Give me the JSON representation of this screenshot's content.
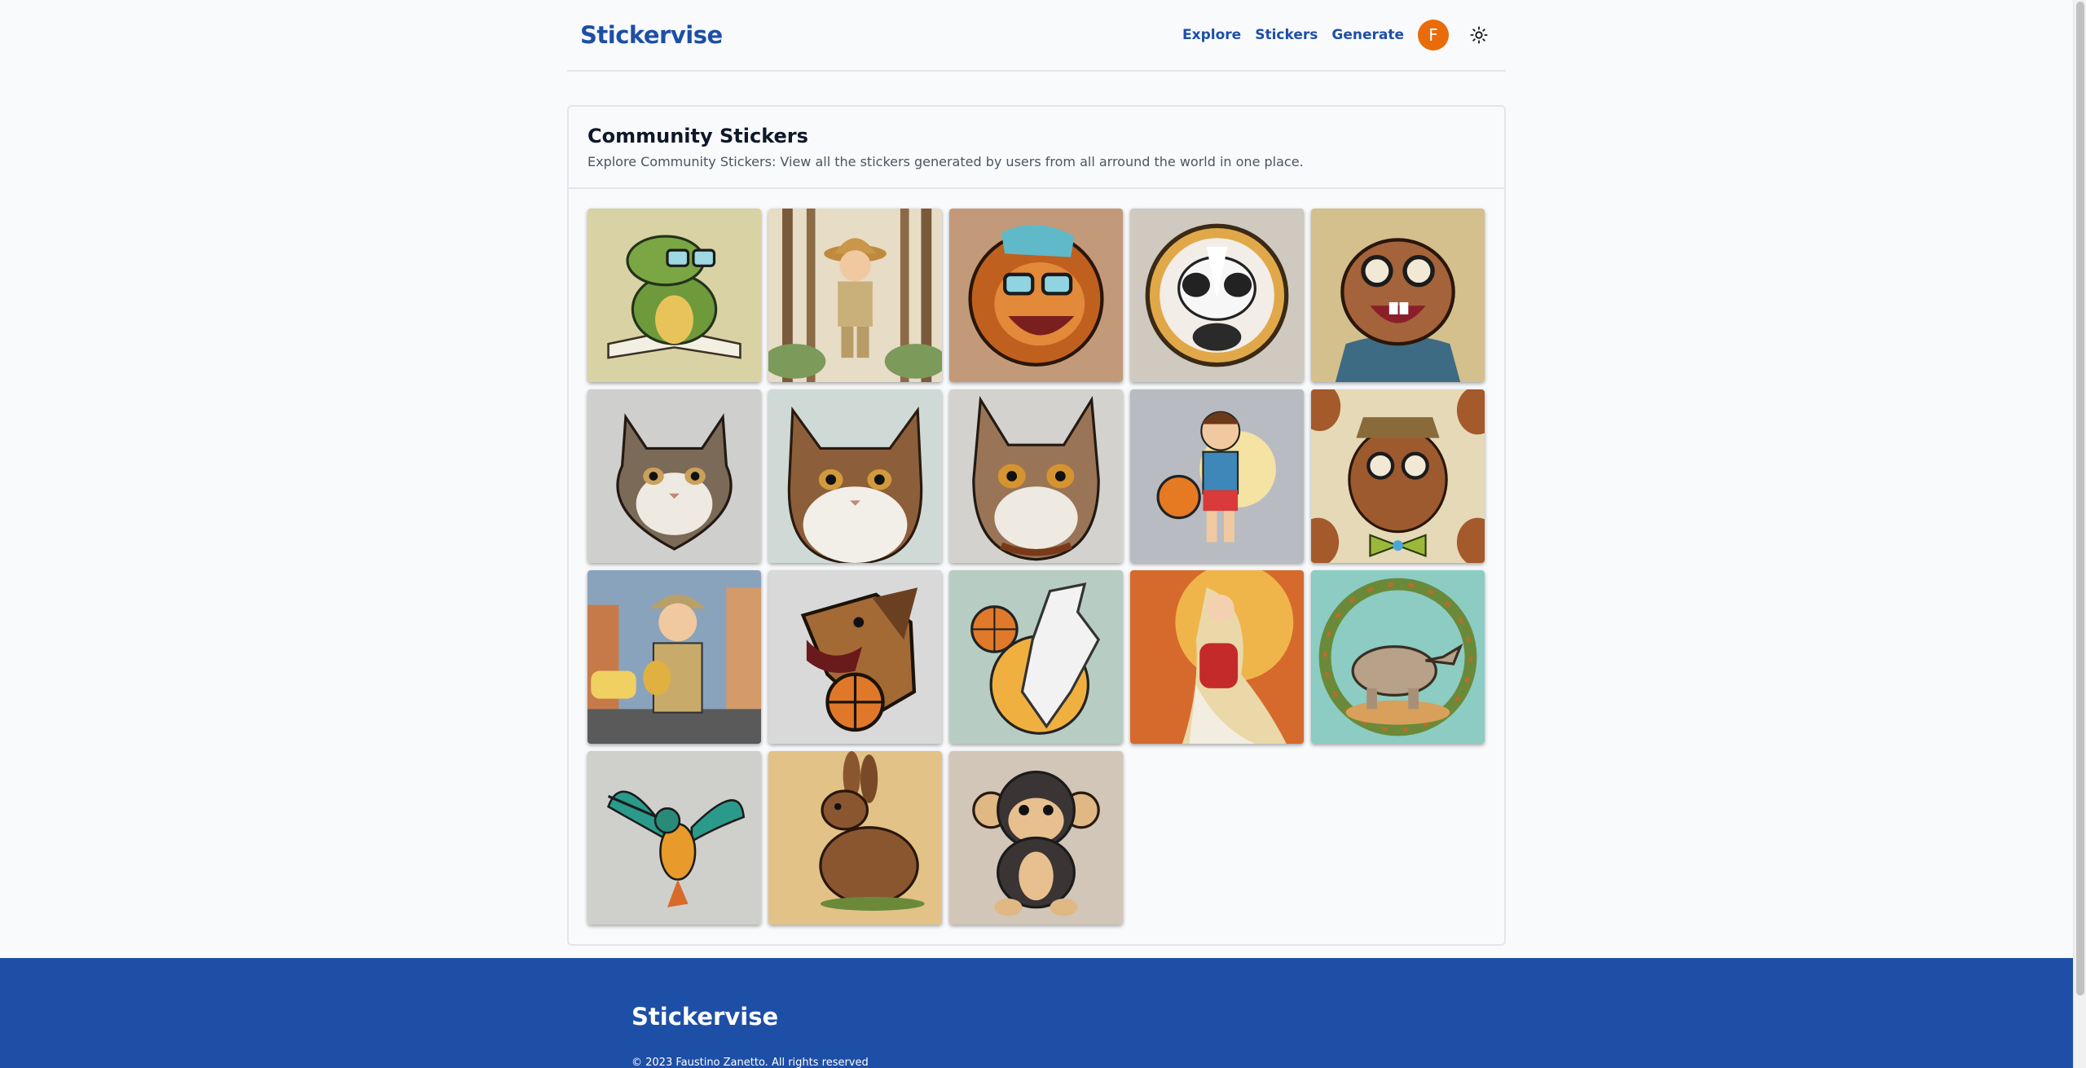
{
  "header": {
    "logo": "Stickervise",
    "nav": [
      {
        "label": "Explore"
      },
      {
        "label": "Stickers"
      },
      {
        "label": "Generate"
      }
    ],
    "avatar_initial": "F"
  },
  "main": {
    "title": "Community Stickers",
    "description": "Explore Community Stickers: View all the stickers generated by users from all arround the world in one place."
  },
  "stickers": [
    {
      "name": "crocodile-reading-book-sticker",
      "bg": "#d9d2a4"
    },
    {
      "name": "boy-scout-forest-sticker",
      "bg": "#e7dcc6"
    },
    {
      "name": "lion-with-glasses-sticker",
      "bg": "#c29a7a"
    },
    {
      "name": "skunk-badge-sticker",
      "bg": "#cfc9bf"
    },
    {
      "name": "beaver-with-glasses-sticker",
      "bg": "#d3c08d"
    },
    {
      "name": "fluffy-cat-sticker",
      "bg": "#cfcfcd"
    },
    {
      "name": "tabby-cat-portrait-sticker",
      "bg": "#cfdad6"
    },
    {
      "name": "cat-with-collar-sticker",
      "bg": "#d3d2ce"
    },
    {
      "name": "boy-basketball-sticker",
      "bg": "#b8bcc2"
    },
    {
      "name": "beaver-bowtie-pattern-sticker",
      "bg": "#e5d9b8"
    },
    {
      "name": "boy-city-street-sticker",
      "bg": "#8aa3bc"
    },
    {
      "name": "dog-basketball-sticker",
      "bg": "#d9d9d9"
    },
    {
      "name": "wolf-basketball-sticker",
      "bg": "#b7cdc3"
    },
    {
      "name": "woman-art-nouveau-sticker",
      "bg": "#d66a2c"
    },
    {
      "name": "rhino-wreath-sticker",
      "bg": "#8cccc3"
    },
    {
      "name": "hummingbird-sticker",
      "bg": "#cfd0cb"
    },
    {
      "name": "rabbit-sticker",
      "bg": "#e2c287"
    },
    {
      "name": "monkey-sticker",
      "bg": "#d2c6b8"
    }
  ],
  "footer": {
    "logo": "Stickervise",
    "copyright": "© 2023 Faustino Zanetto. All rights reserved"
  }
}
